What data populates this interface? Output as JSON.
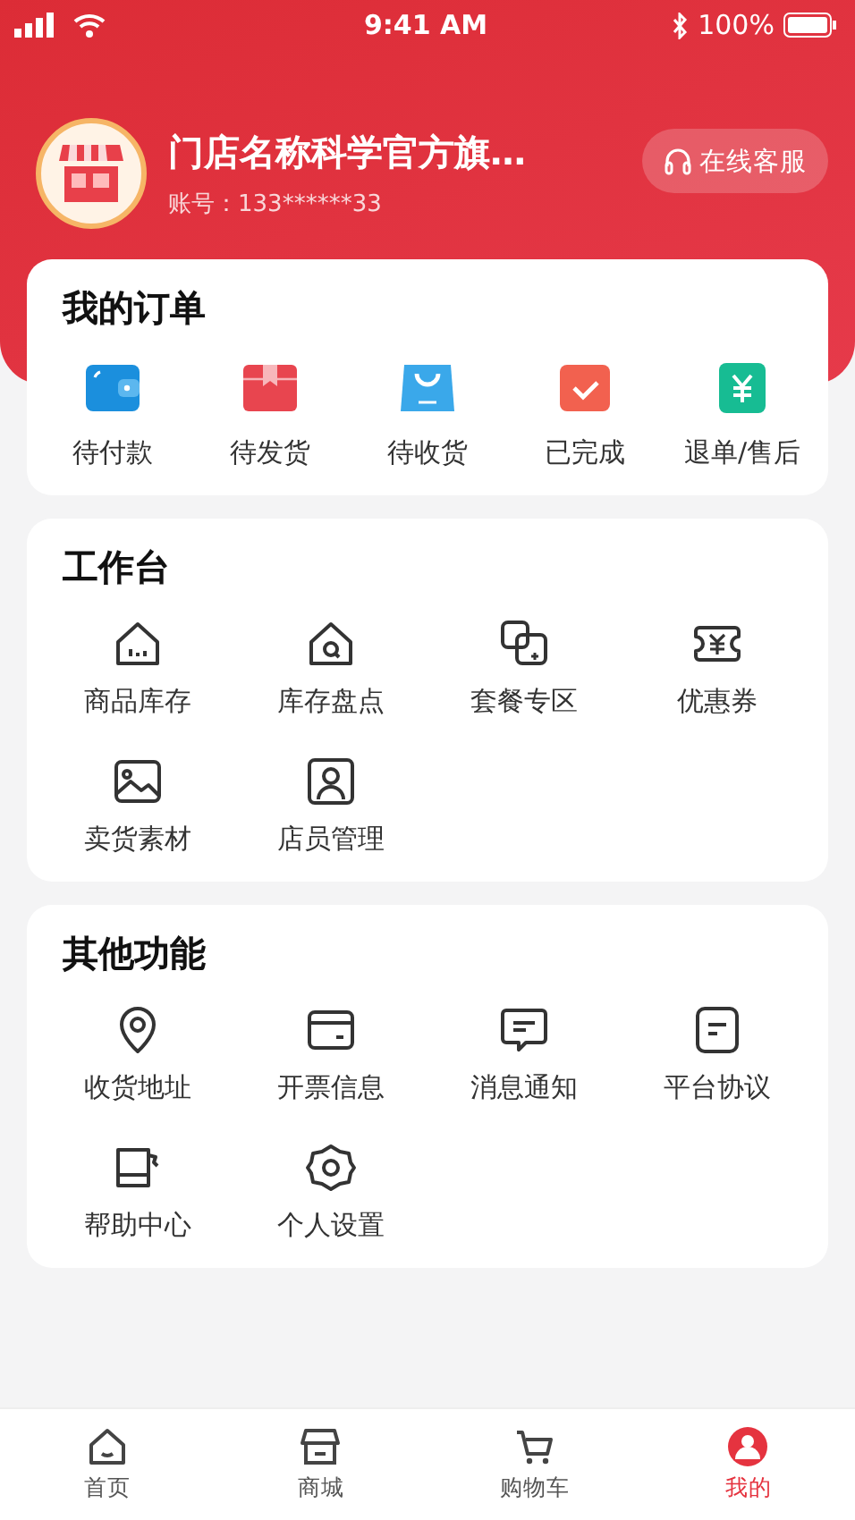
{
  "status_bar": {
    "time": "9:41 AM",
    "battery": "100%"
  },
  "store": {
    "name": "门店名称科学官方旗…",
    "account": "账号：133******33",
    "service_button": "在线客服"
  },
  "orders": {
    "title": "我的订单",
    "items": [
      {
        "label": "待付款"
      },
      {
        "label": "待发货"
      },
      {
        "label": "待收货"
      },
      {
        "label": "已完成"
      },
      {
        "label": "退单/售后"
      }
    ]
  },
  "workbench": {
    "title": "工作台",
    "items": [
      {
        "label": "商品库存"
      },
      {
        "label": "库存盘点"
      },
      {
        "label": "套餐专区"
      },
      {
        "label": "优惠券"
      },
      {
        "label": "卖货素材"
      },
      {
        "label": "店员管理"
      }
    ]
  },
  "other": {
    "title": "其他功能",
    "items": [
      {
        "label": "收货地址"
      },
      {
        "label": "开票信息"
      },
      {
        "label": "消息通知"
      },
      {
        "label": "平台协议"
      },
      {
        "label": "帮助中心"
      },
      {
        "label": "个人设置"
      }
    ]
  },
  "tab_bar": [
    {
      "label": "首页",
      "selected": false
    },
    {
      "label": "商城",
      "selected": false
    },
    {
      "label": "购物车",
      "selected": false
    },
    {
      "label": "我的",
      "selected": true
    }
  ]
}
